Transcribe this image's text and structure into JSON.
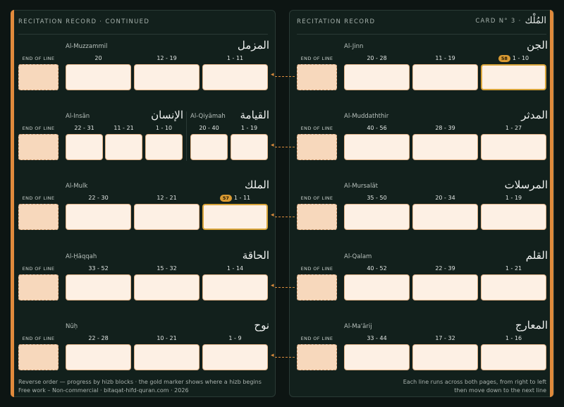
{
  "left_page": {
    "title": "RECITATION RECORD · CONTINUED",
    "footer_line1": "Reverse order — progress by hizb blocks · the gold marker shows where a hizb begins",
    "footer_line2": "Free work – Non-commercial · bitaqat-hifd-quran.com · 2026"
  },
  "right_page": {
    "title": "RECITATION RECORD",
    "card_label": "CARD N° 3 ·",
    "card_arabic": "المُلْك",
    "footer_line1": "Each line runs across both pages, from right to left",
    "footer_line2": "then move down to the next line"
  },
  "eol_label": "END OF LINE",
  "rows": [
    {
      "left": {
        "latin": "Al-Muzzammil",
        "arabic": "المزمل",
        "ranges": [
          "20",
          "12 - 19",
          "1 - 11"
        ]
      },
      "right": {
        "latin": "Al-Jinn",
        "arabic": "الجن",
        "ranges": [
          "20 - 28",
          "11 - 19",
          "1 - 10"
        ],
        "badge": "58"
      }
    },
    {
      "left": {
        "a": {
          "latin": "Al-Insān",
          "arabic": "الإنسان",
          "ranges": [
            "22 - 31",
            "11 - 21",
            "1 - 10"
          ]
        },
        "b": {
          "latin": "Al-Qiyāmah",
          "arabic": "القيامة",
          "ranges": [
            "20 - 40",
            "1 - 19"
          ]
        }
      },
      "right": {
        "latin": "Al-Muddaththir",
        "arabic": "المدثر",
        "ranges": [
          "40 - 56",
          "28 - 39",
          "1 - 27"
        ]
      }
    },
    {
      "left": {
        "latin": "Al-Mulk",
        "arabic": "الملك",
        "ranges": [
          "22 - 30",
          "12 - 21",
          "1 - 11"
        ],
        "badge": "57"
      },
      "right": {
        "latin": "Al-Mursalāt",
        "arabic": "المرسلات",
        "ranges": [
          "35 - 50",
          "20 - 34",
          "1 - 19"
        ]
      }
    },
    {
      "left": {
        "latin": "Al-Ḥāqqah",
        "arabic": "الحاقة",
        "ranges": [
          "33 - 52",
          "15 - 32",
          "1 - 14"
        ]
      },
      "right": {
        "latin": "Al-Qalam",
        "arabic": "القلم",
        "ranges": [
          "40 - 52",
          "22 - 39",
          "1 - 21"
        ]
      }
    },
    {
      "left": {
        "latin": "Nūḥ",
        "arabic": "نوح",
        "ranges": [
          "22 - 28",
          "10 - 21",
          "1 - 9"
        ]
      },
      "right": {
        "latin": "Al-Ma'ārij",
        "arabic": "المعارج",
        "ranges": [
          "33 - 44",
          "17 - 32",
          "1 - 16"
        ]
      }
    }
  ]
}
